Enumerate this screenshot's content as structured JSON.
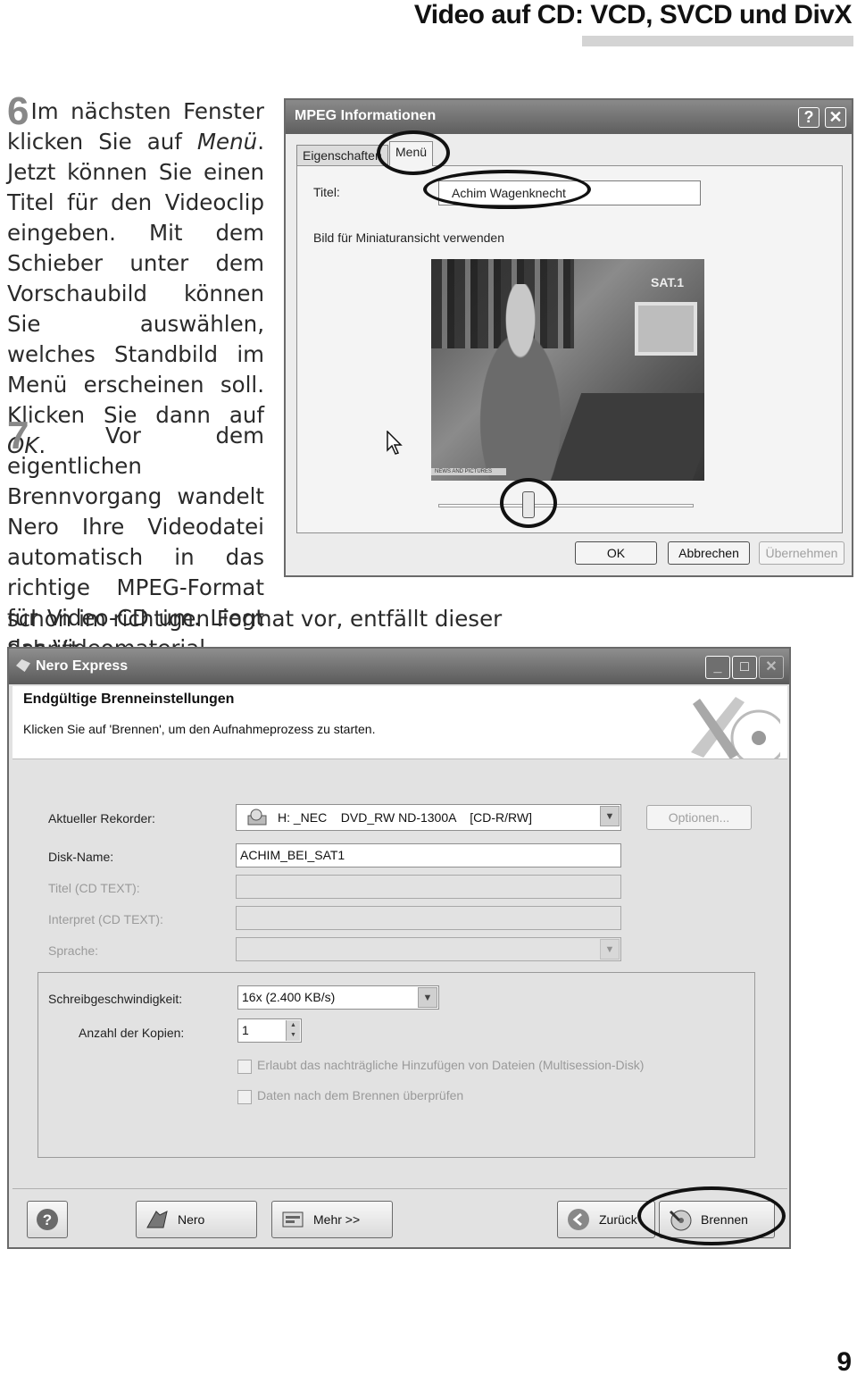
{
  "header": {
    "chapter_title": "Video auf CD: VCD, SVCD und DivX"
  },
  "steps": [
    {
      "number": "6",
      "text_before": "Im nächsten Fenster klicken Sie auf ",
      "em1": "Menü",
      "text_mid": ". Jetzt können Sie einen Titel für den Videoclip eingeben. Mit dem Schieber unter dem Vorschaubild können Sie auswählen, welches Standbild im Menü erscheinen soll. Klicken Sie dann auf ",
      "em2": "OK",
      "text_after": "."
    },
    {
      "number": "7",
      "text": "Vor dem eigentlichen Brennvorgang wandelt Nero Ihre Videodatei automatisch in das richtige MPEG-Format für Video-CD um. Liegt das Videomaterial",
      "tail": "schon im richtigen Format vor, entfällt dieser Schritt."
    }
  ],
  "mpeg_dialog": {
    "title": "MPEG Informationen",
    "help_button": "?",
    "close_button": "✕",
    "tabs": [
      "Eigenschaften",
      "Menü"
    ],
    "active_tab": "Menü",
    "titel_label": "Titel:",
    "titel_value": "Achim Wagenknecht",
    "thumbnail_label": "Bild für Miniaturansicht verwenden",
    "video_overlay_logo": "SAT.1",
    "video_overlay_strip": "NEWS AND PICTURES",
    "buttons": {
      "ok": "OK",
      "cancel": "Abbrechen",
      "apply": "Übernehmen"
    }
  },
  "nero_dialog": {
    "title": "Nero Express",
    "header_title": "Endgültige Brenneinstellungen",
    "header_subtitle": "Klicken Sie auf 'Brennen', um den Aufnahmeprozess zu starten.",
    "recorder_label": "Aktueller Rekorder:",
    "recorder_value": "H: _NEC    DVD_RW ND-1300A    [CD-R/RW]",
    "options_button": "Optionen...",
    "disk_name_label": "Disk-Name:",
    "disk_name_value": "ACHIM_BEI_SAT1",
    "cd_text_title_label": "Titel (CD TEXT):",
    "cd_text_artist_label": "Interpret (CD TEXT):",
    "language_label": "Sprache:",
    "speed_label": "Schreibgeschwindigkeit:",
    "speed_value": "16x (2.400 KB/s)",
    "copies_label": "Anzahl der Kopien:",
    "copies_value": "1",
    "checkbox_multisession": "Erlaubt das nachträgliche Hinzufügen von Dateien (Multisession-Disk)",
    "checkbox_verify": "Daten nach dem Brennen überprüfen",
    "buttons": {
      "help": "?",
      "nero": "Nero",
      "more": "Mehr >>",
      "back": "Zurück",
      "burn": "Brennen"
    },
    "window_buttons": {
      "minimize": "_",
      "maximize": "□",
      "close": "✕"
    }
  },
  "page_number": "9"
}
